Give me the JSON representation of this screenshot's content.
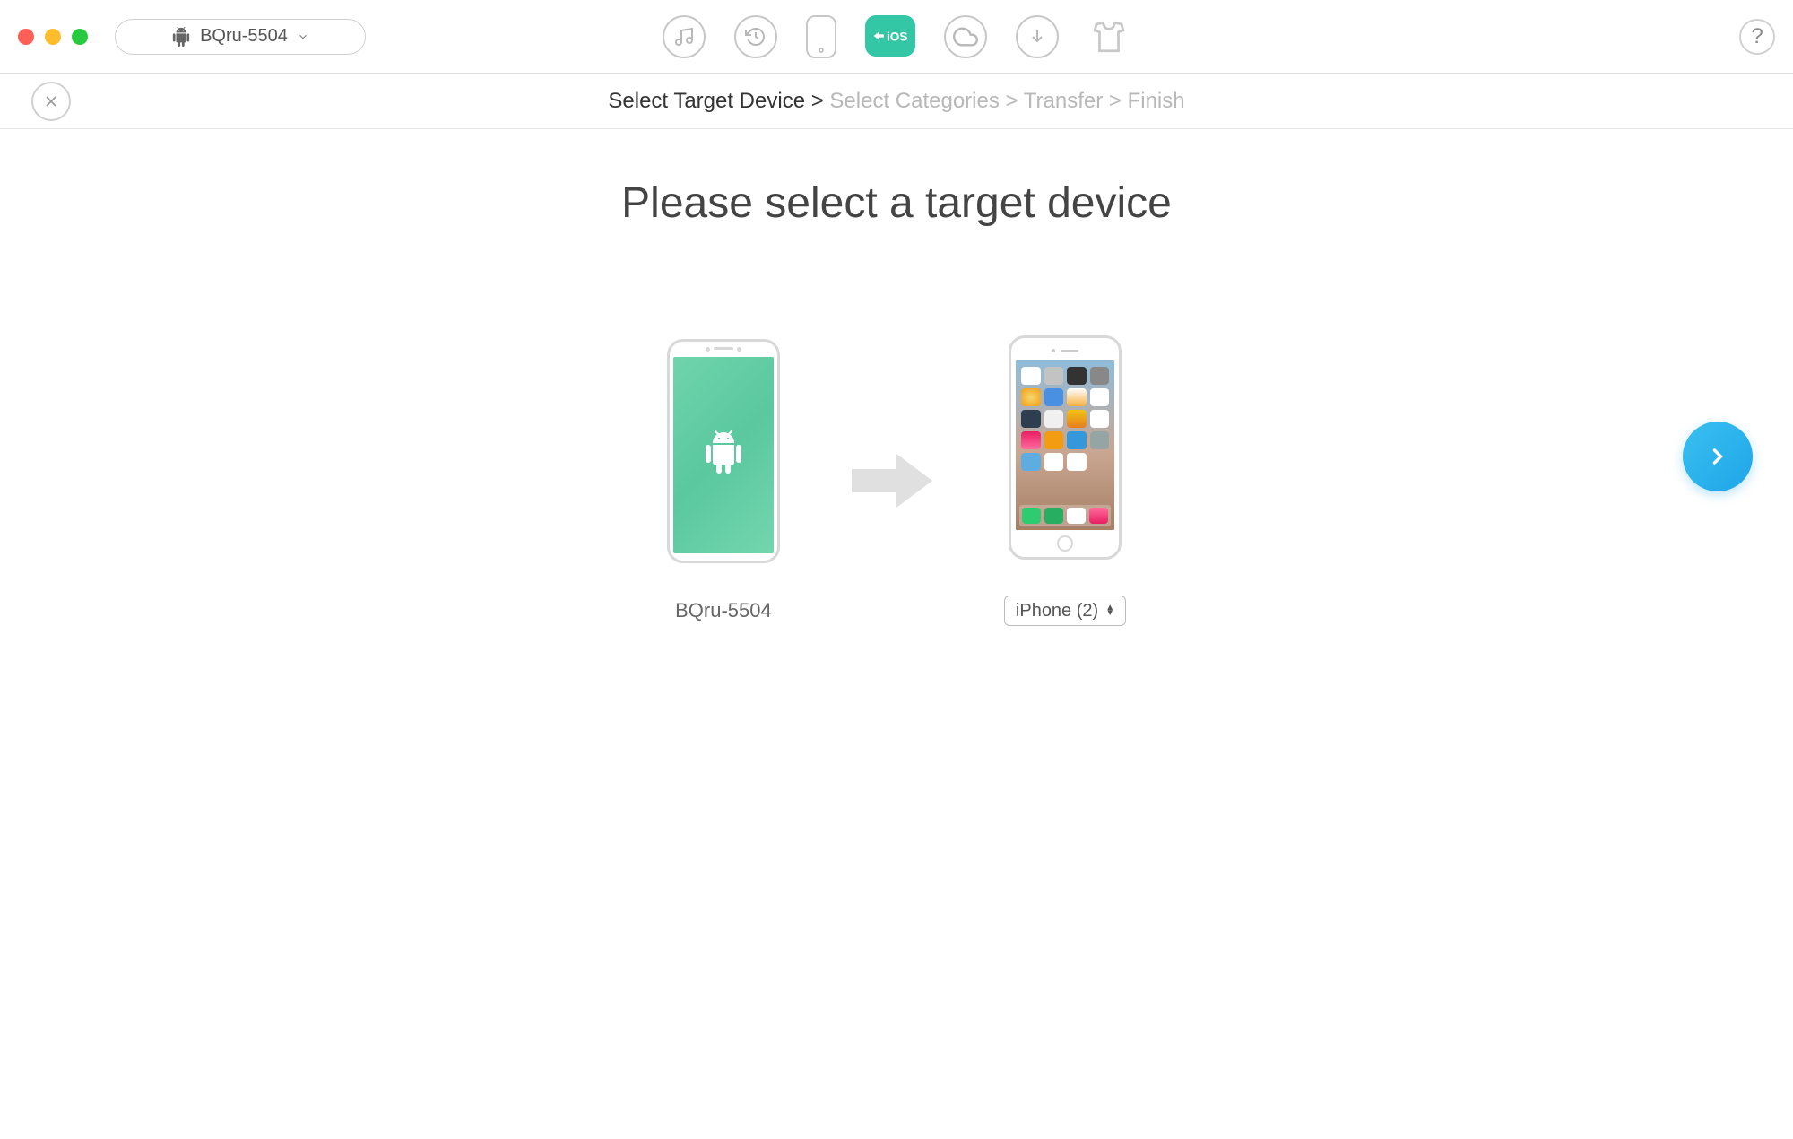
{
  "toolbar": {
    "device_name": "BQru-5504"
  },
  "breadcrumb": {
    "step1": "Select Target Device",
    "step2": "Select Categories",
    "step3": "Transfer",
    "step4": "Finish",
    "separator": " > "
  },
  "main": {
    "heading": "Please select a target device",
    "source_device": "BQru-5504",
    "target_device": "iPhone (2)"
  },
  "help_label": "?"
}
